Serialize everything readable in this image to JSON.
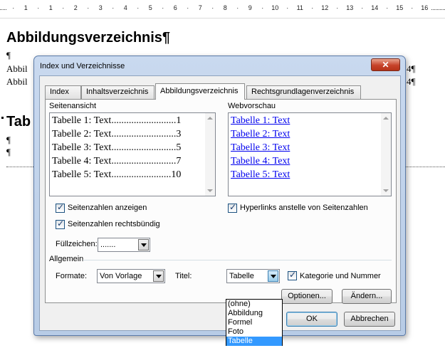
{
  "ruler": {
    "marks": [
      "·",
      "1",
      "·",
      "1",
      "·",
      "2",
      "·",
      "3",
      "·",
      "4",
      "·",
      "5",
      "·",
      "6",
      "·",
      "7",
      "·",
      "8",
      "·",
      "9",
      "·",
      "10",
      "·",
      "11",
      "·",
      "12",
      "·",
      "13",
      "·",
      "14",
      "·",
      "15",
      "·",
      "16"
    ]
  },
  "document": {
    "heading1": "Abbildungsverzeichnis¶",
    "para_mark": "¶",
    "line1_start": "Abbil",
    "line2_start": "Abbil",
    "line1_end": "4¶",
    "line2_end": "4¶",
    "heading2_start": "Tab",
    "para_mark2": "¶",
    "para_mark3": "¶"
  },
  "dialog": {
    "title": "Index und Verzeichnisse",
    "close": "✕",
    "tabs": [
      {
        "label": "Index",
        "active": false
      },
      {
        "label": "Inhaltsverzeichnis",
        "active": false
      },
      {
        "label": "Abbildungsverzeichnis",
        "active": true
      },
      {
        "label": "Rechtsgrundlagenverzeichnis",
        "active": false
      }
    ],
    "seitenansicht": {
      "label": "Seitenansicht",
      "rows": [
        {
          "text": "Tabelle 1: Text",
          "dots": "..........................",
          "page": "1"
        },
        {
          "text": "Tabelle 2: Text",
          "dots": "..........................",
          "page": "3"
        },
        {
          "text": "Tabelle 3: Text",
          "dots": "..........................",
          "page": "5"
        },
        {
          "text": "Tabelle 4: Text",
          "dots": "..........................",
          "page": "7"
        },
        {
          "text": "Tabelle 5: Text",
          "dots": "........................",
          "page": "10"
        }
      ]
    },
    "webvorschau": {
      "label": "Webvorschau",
      "links": [
        "Tabelle 1: Text",
        "Tabelle 2: Text",
        "Tabelle 3: Text",
        "Tabelle 4: Text",
        "Tabelle 5: Text"
      ]
    },
    "checkbox_seitenzahlen": {
      "label": "Seitenzahlen anzeigen",
      "checked": true
    },
    "checkbox_rechtsbuendig": {
      "label": "Seitenzahlen rechtsbündig",
      "checked": true
    },
    "checkbox_hyperlinks": {
      "label": "Hyperlinks anstelle von Seitenzahlen",
      "checked": true
    },
    "fuellzeichen": {
      "label": "Füllzeichen:",
      "value": "......."
    },
    "allgemein": {
      "label": "Allgemein",
      "formate_label": "Formate:",
      "formate_value": "Von Vorlage",
      "titel_label": "Titel:",
      "titel_value": "Tabelle",
      "titel_options": [
        "(ohne)",
        "Abbildung",
        "Formel",
        "Foto",
        "Tabelle"
      ],
      "titel_selected": "Tabelle",
      "kategorie": {
        "label": "Kategorie und Nummer",
        "checked": true
      }
    },
    "buttons": {
      "optionen": "Optionen...",
      "aendern": "Ändern...",
      "ok": "OK",
      "abbrechen": "Abbrechen"
    }
  }
}
